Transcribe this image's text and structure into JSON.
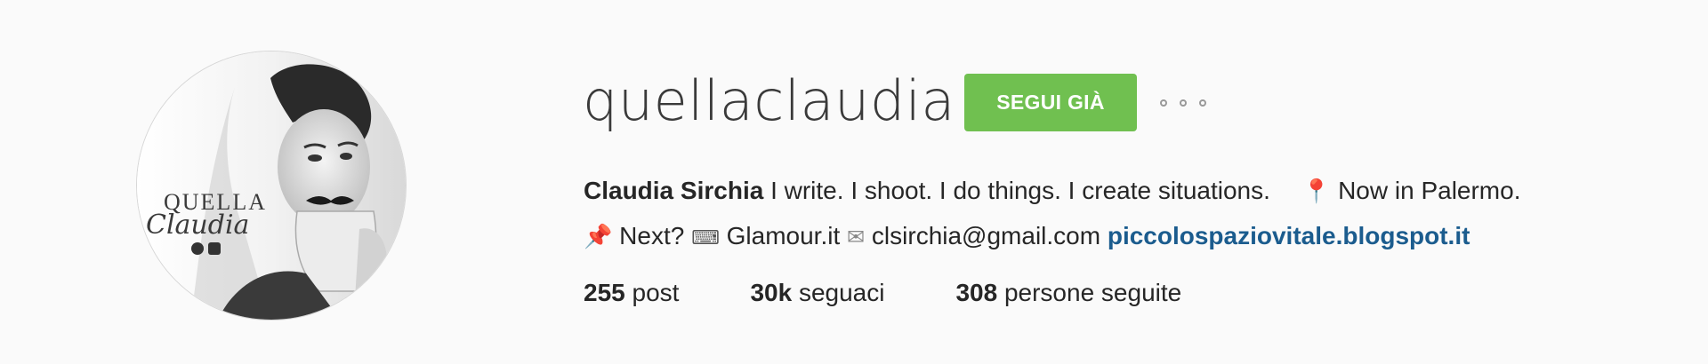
{
  "profile": {
    "username": "quellaclaudia",
    "follow_button_label": "SEGUI GIÀ",
    "avatar_text_top": "QUELLA",
    "avatar_text_script": "Claudia",
    "bio": {
      "name": "Claudia Sirchia",
      "description": "I write. I shoot. I do things. I create situations.",
      "location_text": "Now in Palermo.",
      "next_text": "Next?",
      "work_text": "Glamour.it",
      "email": "clsirchia@gmail.com",
      "link_text": "piccolospaziovitale.blogspot.it",
      "icons": [
        "round-pushpin-icon",
        "pushpin-icon",
        "keyboard-icon",
        "envelope-icon"
      ]
    },
    "stats": {
      "posts_count": "255",
      "posts_label": "post",
      "followers_count": "30k",
      "followers_label": "seguaci",
      "following_count": "308",
      "following_label": "persone seguite"
    }
  },
  "colors": {
    "background": "#fafafa",
    "follow_button": "#70c050",
    "link": "#1b5c8e",
    "text": "#262626"
  }
}
